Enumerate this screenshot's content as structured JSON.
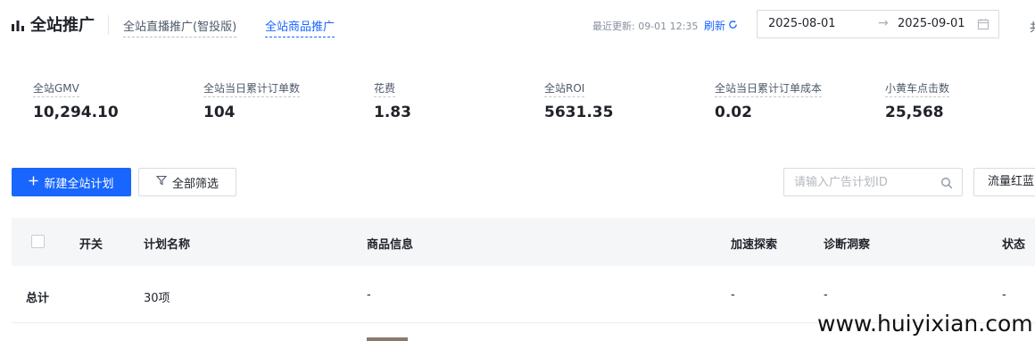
{
  "header": {
    "title": "全站推广",
    "tabs": [
      {
        "label": "全站直播推广(智投版)",
        "active": false
      },
      {
        "label": "全站商品推广",
        "active": true
      }
    ],
    "last_update": "最近更新: 09-01 12:35",
    "refresh_label": "刷新",
    "date_start": "2025-08-01",
    "date_end": "2025-09-01",
    "date_separator": "→",
    "cut_text": "共"
  },
  "metrics": [
    {
      "label": "全站GMV",
      "value": "10,294.10"
    },
    {
      "label": "全站当日累计订单数",
      "value": "104"
    },
    {
      "label": "花费",
      "value": "1.83"
    },
    {
      "label": "全站ROI",
      "value": "5631.35"
    },
    {
      "label": "全站当日累计订单成本",
      "value": "0.02"
    },
    {
      "label": "小黄车点击数",
      "value": "25,568"
    }
  ],
  "toolbar": {
    "create_label": "新建全站计划",
    "filter_label": "全部筛选",
    "search_placeholder": "请输入广告计划ID",
    "traffic_label": "流量红蓝"
  },
  "table": {
    "columns": [
      "开关",
      "计划名称",
      "商品信息",
      "加速探索",
      "诊断洞察",
      "状态"
    ],
    "summary_row": {
      "label": "总计",
      "plan_count": "30项",
      "product_info": "-",
      "accelerate": "-",
      "diagnosis": "-",
      "status": "-"
    }
  },
  "watermark": "www.huiyixian.com",
  "colors": {
    "accent": "#1966ff",
    "header_bg": "#f5f6f8"
  }
}
